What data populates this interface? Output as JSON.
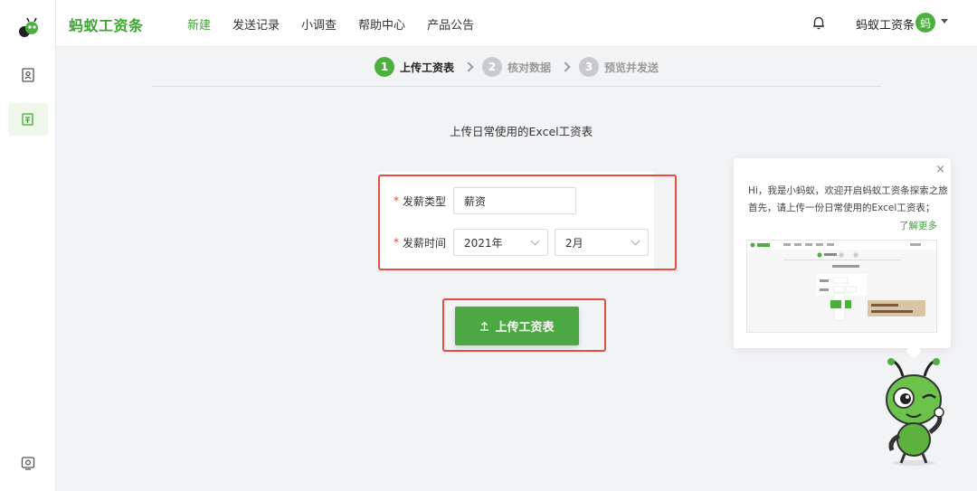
{
  "app": {
    "brand": "蚂蚁工资条",
    "nav": [
      {
        "label": "新建",
        "active": true
      },
      {
        "label": "发送记录",
        "active": false
      },
      {
        "label": "小调查",
        "active": false
      },
      {
        "label": "帮助中心",
        "active": false
      },
      {
        "label": "产品公告",
        "active": false
      }
    ],
    "user": {
      "name": "蚂蚁工资条",
      "avatar_char": "蚂"
    },
    "accent_color": "#4caf3e",
    "highlight_color": "#e54d3e"
  },
  "sidebar": {
    "items": [
      {
        "icon": "address-book-icon",
        "active": false
      },
      {
        "icon": "payslip-icon",
        "active": true
      },
      {
        "icon": "settings-icon",
        "active": false
      }
    ]
  },
  "steps": [
    {
      "num": "1",
      "label": "上传工资表",
      "active": true
    },
    {
      "num": "2",
      "label": "核对数据",
      "active": false
    },
    {
      "num": "3",
      "label": "预览并发送",
      "active": false
    }
  ],
  "main": {
    "subtitle": "上传日常使用的Excel工资表",
    "form": {
      "type_label": "发薪类型",
      "type_value": "薪资",
      "time_label": "发薪时间",
      "year_value": "2021年",
      "month_value": "2月",
      "required_mark": "*"
    },
    "upload_label": "上传工资表",
    "upload_icon": "upload-icon"
  },
  "guide": {
    "close": "×",
    "line1": "Hi，我是小蚂蚁，欢迎开启蚂蚁工资条探索之旅",
    "line2": "首先，请上传一份日常使用的Excel工资表；",
    "more": "了解更多"
  }
}
